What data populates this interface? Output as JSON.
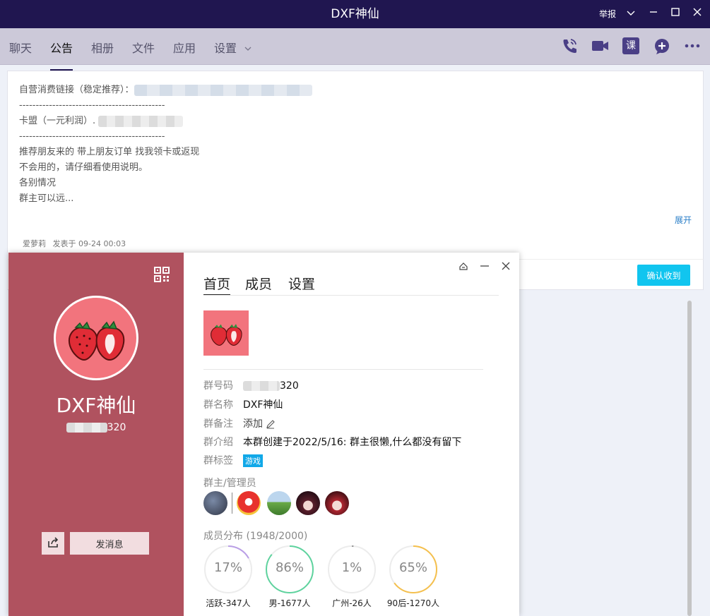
{
  "window": {
    "title": "DXF神仙",
    "report": "举报"
  },
  "tabs": [
    {
      "label": "聊天"
    },
    {
      "label": "公告"
    },
    {
      "label": "相册"
    },
    {
      "label": "文件"
    },
    {
      "label": "应用"
    },
    {
      "label": "设置"
    }
  ],
  "toolbar_icons": [
    "phone-call-icon",
    "video-call-icon",
    "course-icon",
    "add-app-icon",
    "more-icon"
  ],
  "toolbar": {
    "course": "课"
  },
  "announcement": {
    "line1": "自营消费链接（稳定推荐）：",
    "divider": "--------------------------------------------",
    "line2": "卡盟（一元利润）.",
    "line3": "推荐朋友来的 带上朋友订单 找我领卡或返现",
    "line4": "不会用的，请仔细看使用说明。",
    "line5": "各别情况",
    "line6": "群主可以远...",
    "expand": "展开",
    "author": "爱萝莉",
    "posted": "发表于 09-24 00:03",
    "confirm": "确认收到"
  },
  "card": {
    "group_name": "DXF神仙",
    "group_number_suffix": "320",
    "send_message": "发消息",
    "tabs": [
      "首页",
      "成员",
      "设置"
    ],
    "fields": {
      "number_label": "群号码",
      "number_value": "320",
      "name_label": "群名称",
      "name_value": "DXF神仙",
      "remark_label": "群备注",
      "remark_value": "添加",
      "intro_label": "群介绍",
      "intro_value": "本群创建于2022/5/16:  群主很懒,什么都没有留下",
      "tag_label": "群标签",
      "tag_value": "游戏"
    },
    "admins_label": "群主/管理员",
    "distribution_label": "成员分布 (1948/2000)",
    "stats": [
      {
        "percent": 17,
        "display": "17%",
        "label": "活跃-347人",
        "color": "#b99ee6"
      },
      {
        "percent": 86,
        "display": "86%",
        "label": "男-1677人",
        "color": "#5ed39e"
      },
      {
        "percent": 1,
        "display": "1%",
        "label": "广州-26人",
        "color": "#999999"
      },
      {
        "percent": 65,
        "display": "65%",
        "label": "90后-1270人",
        "color": "#f5c04d"
      }
    ]
  }
}
